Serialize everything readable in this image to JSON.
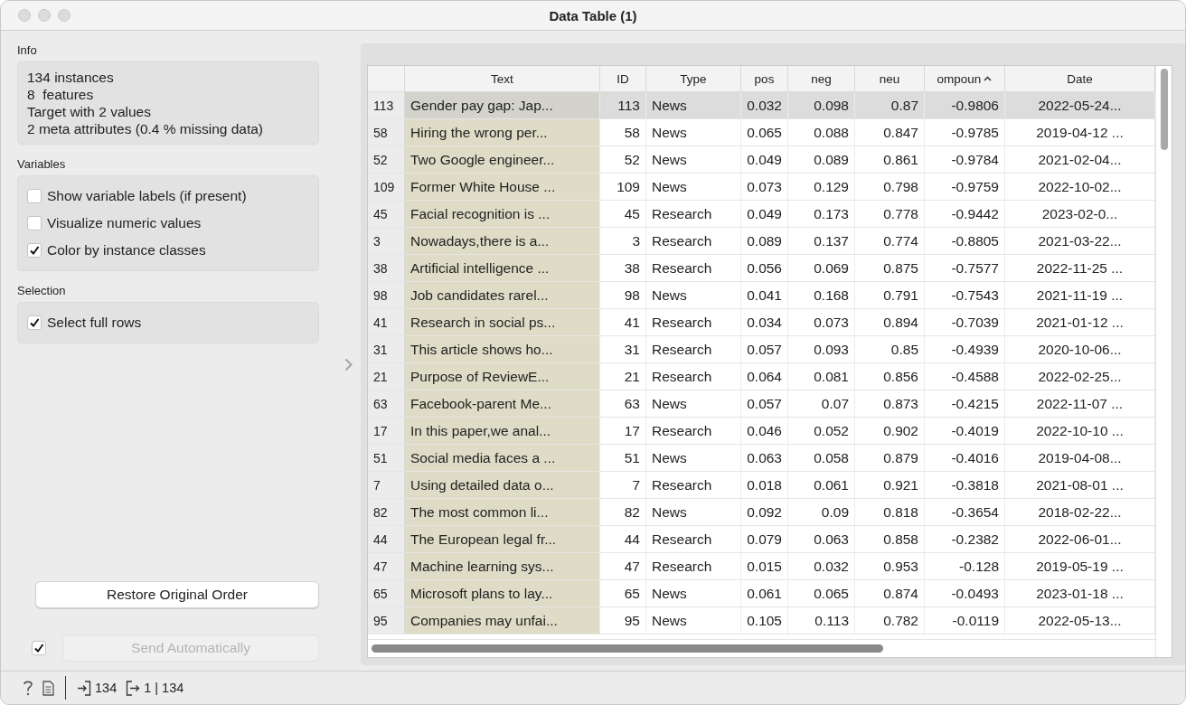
{
  "window": {
    "title": "Data Table (1)"
  },
  "info": {
    "title": "Info",
    "lines": [
      "134 instances",
      "8  features",
      "Target with 2 values",
      "2 meta attributes (0.4 % missing data)"
    ]
  },
  "variables": {
    "title": "Variables",
    "options": [
      {
        "label": "Show variable labels (if present)",
        "checked": false
      },
      {
        "label": "Visualize numeric values",
        "checked": false
      },
      {
        "label": "Color by instance classes",
        "checked": true
      }
    ]
  },
  "selection": {
    "title": "Selection",
    "options": [
      {
        "label": "Select full rows",
        "checked": true
      }
    ]
  },
  "restore_button": "Restore Original Order",
  "send": {
    "label": "Send Automatically",
    "checked": true,
    "disabled": true
  },
  "table": {
    "columns": [
      {
        "label": "Text",
        "kind": "text"
      },
      {
        "label": "ID",
        "kind": "numeric"
      },
      {
        "label": "Type",
        "kind": "text"
      },
      {
        "label": "pos",
        "kind": "numeric"
      },
      {
        "label": "neg",
        "kind": "numeric"
      },
      {
        "label": "neu",
        "kind": "numeric"
      },
      {
        "label": "ompoun",
        "kind": "numeric",
        "sorted": true
      },
      {
        "label": "Date",
        "kind": "date"
      }
    ],
    "rows": [
      {
        "index": "113",
        "selected": true,
        "cells": [
          "Gender pay gap: Jap...",
          "113",
          "News",
          "0.032",
          "0.098",
          "0.87",
          "-0.9806",
          "2022-05-24..."
        ]
      },
      {
        "index": "58",
        "selected": false,
        "cells": [
          "Hiring the wrong per...",
          "58",
          "News",
          "0.065",
          "0.088",
          "0.847",
          "-0.9785",
          "2019-04-12 ..."
        ]
      },
      {
        "index": "52",
        "selected": false,
        "cells": [
          "Two Google engineer...",
          "52",
          "News",
          "0.049",
          "0.089",
          "0.861",
          "-0.9784",
          "2021-02-04..."
        ]
      },
      {
        "index": "109",
        "selected": false,
        "cells": [
          "Former White House ...",
          "109",
          "News",
          "0.073",
          "0.129",
          "0.798",
          "-0.9759",
          "2022-10-02..."
        ]
      },
      {
        "index": "45",
        "selected": false,
        "cells": [
          "Facial recognition is ...",
          "45",
          "Research",
          "0.049",
          "0.173",
          "0.778",
          "-0.9442",
          "2023-02-0..."
        ]
      },
      {
        "index": "3",
        "selected": false,
        "cells": [
          "Nowadays,there is a...",
          "3",
          "Research",
          "0.089",
          "0.137",
          "0.774",
          "-0.8805",
          "2021-03-22..."
        ]
      },
      {
        "index": "38",
        "selected": false,
        "cells": [
          "Artificial intelligence ...",
          "38",
          "Research",
          "0.056",
          "0.069",
          "0.875",
          "-0.7577",
          "2022-11-25 ..."
        ]
      },
      {
        "index": "98",
        "selected": false,
        "cells": [
          "Job candidates rarel...",
          "98",
          "News",
          "0.041",
          "0.168",
          "0.791",
          "-0.7543",
          "2021-11-19 ..."
        ]
      },
      {
        "index": "41",
        "selected": false,
        "cells": [
          "Research in social ps...",
          "41",
          "Research",
          "0.034",
          "0.073",
          "0.894",
          "-0.7039",
          "2021-01-12 ..."
        ]
      },
      {
        "index": "31",
        "selected": false,
        "cells": [
          "This article shows ho...",
          "31",
          "Research",
          "0.057",
          "0.093",
          "0.85",
          "-0.4939",
          "2020-10-06..."
        ]
      },
      {
        "index": "21",
        "selected": false,
        "cells": [
          "Purpose of ReviewE...",
          "21",
          "Research",
          "0.064",
          "0.081",
          "0.856",
          "-0.4588",
          "2022-02-25..."
        ]
      },
      {
        "index": "63",
        "selected": false,
        "cells": [
          "Facebook-parent Me...",
          "63",
          "News",
          "0.057",
          "0.07",
          "0.873",
          "-0.4215",
          "2022-11-07 ..."
        ]
      },
      {
        "index": "17",
        "selected": false,
        "cells": [
          "In this paper,we anal...",
          "17",
          "Research",
          "0.046",
          "0.052",
          "0.902",
          "-0.4019",
          "2022-10-10 ..."
        ]
      },
      {
        "index": "51",
        "selected": false,
        "cells": [
          "Social media faces a ...",
          "51",
          "News",
          "0.063",
          "0.058",
          "0.879",
          "-0.4016",
          "2019-04-08..."
        ]
      },
      {
        "index": "7",
        "selected": false,
        "cells": [
          "Using detailed data o...",
          "7",
          "Research",
          "0.018",
          "0.061",
          "0.921",
          "-0.3818",
          "2021-08-01 ..."
        ]
      },
      {
        "index": "82",
        "selected": false,
        "cells": [
          "The most common li...",
          "82",
          "News",
          "0.092",
          "0.09",
          "0.818",
          "-0.3654",
          "2018-02-22..."
        ]
      },
      {
        "index": "44",
        "selected": false,
        "cells": [
          "The European legal fr...",
          "44",
          "Research",
          "0.079",
          "0.063",
          "0.858",
          "-0.2382",
          "2022-06-01..."
        ]
      },
      {
        "index": "47",
        "selected": false,
        "cells": [
          "Machine learning sys...",
          "47",
          "Research",
          "0.015",
          "0.032",
          "0.953",
          "-0.128",
          "2019-05-19 ..."
        ]
      },
      {
        "index": "65",
        "selected": false,
        "cells": [
          "Microsoft plans to lay...",
          "65",
          "News",
          "0.061",
          "0.065",
          "0.874",
          "-0.0493",
          "2023-01-18 ..."
        ]
      },
      {
        "index": "95",
        "selected": false,
        "cells": [
          "Companies may unfai...",
          "95",
          "News",
          "0.105",
          "0.113",
          "0.782",
          "-0.0119",
          "2022-05-13..."
        ]
      }
    ]
  },
  "status_bar": {
    "input_count": "134",
    "output_count": "1 | 134"
  }
}
